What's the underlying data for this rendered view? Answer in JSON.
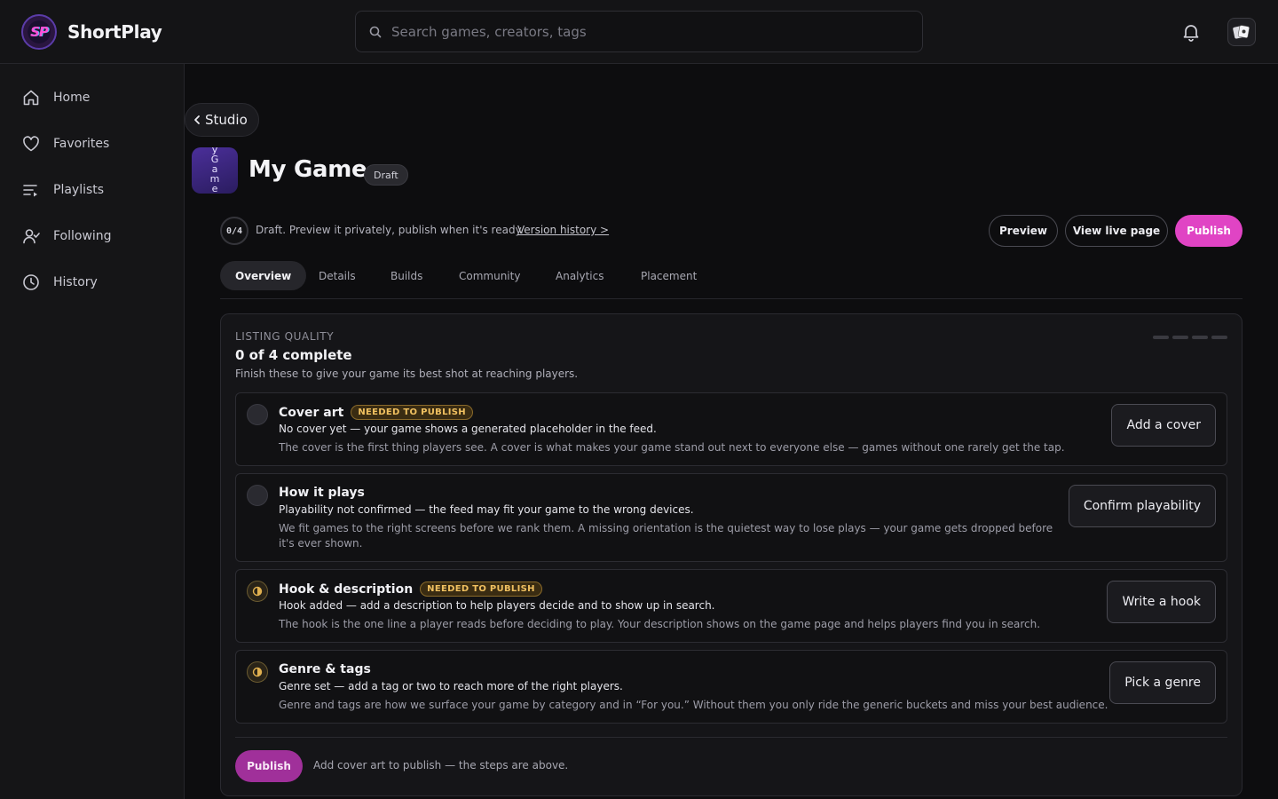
{
  "app": {
    "brand": "ShortPlay",
    "logo_text": "SP"
  },
  "search": {
    "placeholder": "Search games, creators, tags"
  },
  "sidebar": {
    "items": [
      {
        "label": "Home",
        "icon": "home-icon"
      },
      {
        "label": "Favorites",
        "icon": "heart-icon"
      },
      {
        "label": "Playlists",
        "icon": "playlist-icon"
      },
      {
        "label": "Following",
        "icon": "following-icon"
      },
      {
        "label": "History",
        "icon": "clock-icon"
      }
    ]
  },
  "page": {
    "back_label": "Studio",
    "game_title": "My Game",
    "thumb_letters": [
      "y",
      "G",
      "a",
      "m",
      "e"
    ],
    "status_badge": "Draft",
    "progress": "0/4",
    "draft_note": "Draft. Preview it privately, publish when it's ready.",
    "version_link": "Version history >",
    "actions": {
      "preview": "Preview",
      "view_live": "View live page",
      "publish": "Publish"
    },
    "tabs": [
      "Overview",
      "Details",
      "Builds",
      "Community",
      "Analytics",
      "Placement"
    ],
    "active_tab": "Overview"
  },
  "listing": {
    "label": "LISTING QUALITY",
    "title": "0 of 4 complete",
    "subtitle": "Finish these to give your game its best shot at reaching players.",
    "completed": 0,
    "total": 4,
    "tasks": [
      {
        "title": "Cover art",
        "badge": "NEEDED TO PUBLISH",
        "status_state": "empty",
        "status": "No cover yet — your game shows a generated placeholder in the feed.",
        "description": "The cover is the first thing players see. A cover is what makes your game stand out next to everyone else — games without one rarely get the tap.",
        "button": "Add a cover"
      },
      {
        "title": "How it plays",
        "badge": "",
        "status_state": "empty",
        "status": "Playability not confirmed — the feed may fit your game to the wrong devices.",
        "description": "We fit games to the right screens before we rank them. A missing orientation is the quietest way to lose plays — your game gets dropped before it's ever shown.",
        "button": "Confirm playability"
      },
      {
        "title": "Hook & description",
        "badge": "NEEDED TO PUBLISH",
        "status_state": "partial",
        "status": "Hook added — add a description to help players decide and to show up in search.",
        "description": "The hook is the one line a player reads before deciding to play. Your description shows on the game page and helps players find you in search.",
        "button": "Write a hook"
      },
      {
        "title": "Genre & tags",
        "badge": "",
        "status_state": "partial",
        "status": "Genre set — add a tag or two to reach more of the right players.",
        "description": "Genre and tags are how we surface your game by category and in “For you.” Without them you only ride the generic buckets and miss your best audience.",
        "button": "Pick a genre"
      }
    ],
    "footer_publish": "Publish",
    "footer_note": "Add cover art to publish — the steps are above."
  },
  "colors": {
    "accent": "#e044c4",
    "accent_dim": "#a0309a",
    "warning": "#f0c060",
    "background": "#0d0d0f"
  }
}
